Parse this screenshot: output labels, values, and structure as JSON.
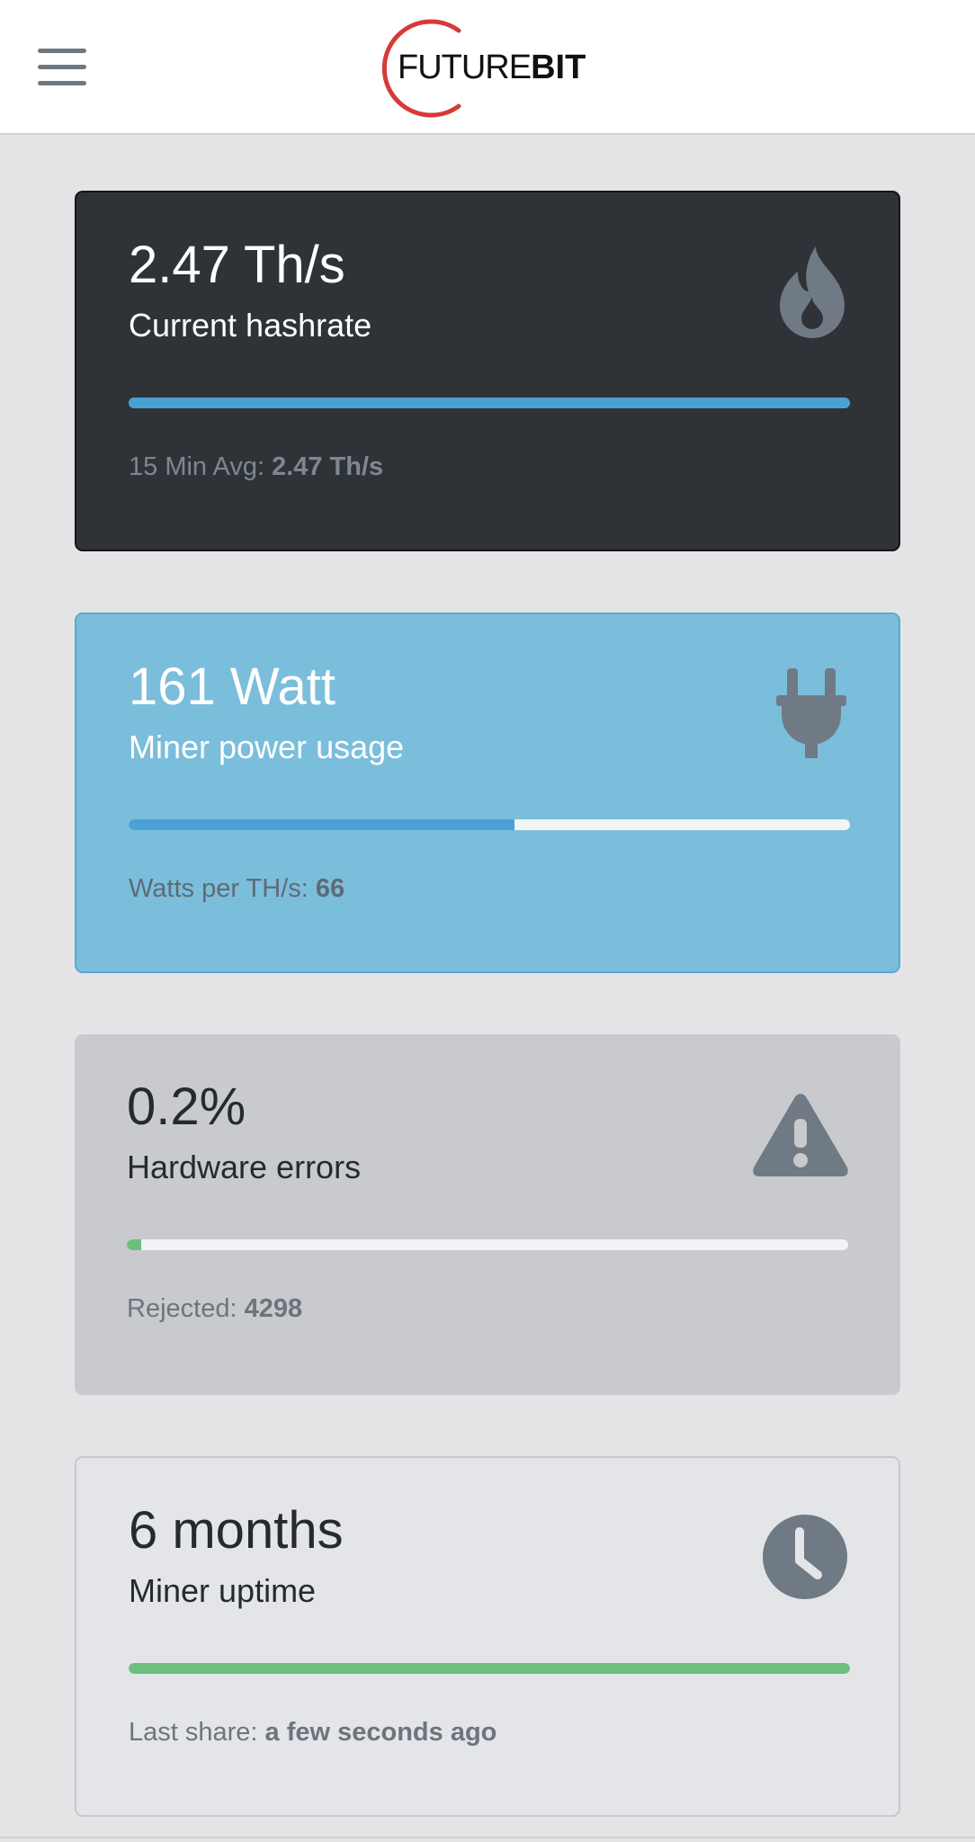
{
  "header": {
    "menu_icon": "hamburger-menu-icon",
    "logo_light": "FUTURE",
    "logo_bold": "BIT",
    "logo_colors": {
      "arc": "#d63a38",
      "text": "#111111"
    }
  },
  "cards": [
    {
      "value": "2.47 Th/s",
      "label": "Current hashrate",
      "foot_label": "15 Min Avg: ",
      "foot_value": "2.47 Th/s",
      "progress": 1.0,
      "icon": "fire-icon",
      "bar_color": "#4aa1d4"
    },
    {
      "value": "161 Watt",
      "label": "Miner power usage",
      "foot_label": "Watts per TH/s: ",
      "foot_value": "66",
      "progress": 0.535,
      "icon": "plug-icon",
      "bar_color": "#4aa1d4"
    },
    {
      "value": "0.2%",
      "label": "Hardware errors",
      "foot_label": "Rejected: ",
      "foot_value": "4298",
      "progress": 0.02,
      "icon": "warning-icon",
      "bar_color": "#6cbf7c"
    },
    {
      "value": "6 months",
      "label": "Miner uptime",
      "foot_label": "Last share: ",
      "foot_value": "a few seconds ago",
      "progress": 1.0,
      "icon": "clock-icon",
      "bar_color": "#6cbf7c"
    }
  ],
  "colors": {
    "icon": "#6f7a85",
    "page_background": "#e4e4e6"
  }
}
